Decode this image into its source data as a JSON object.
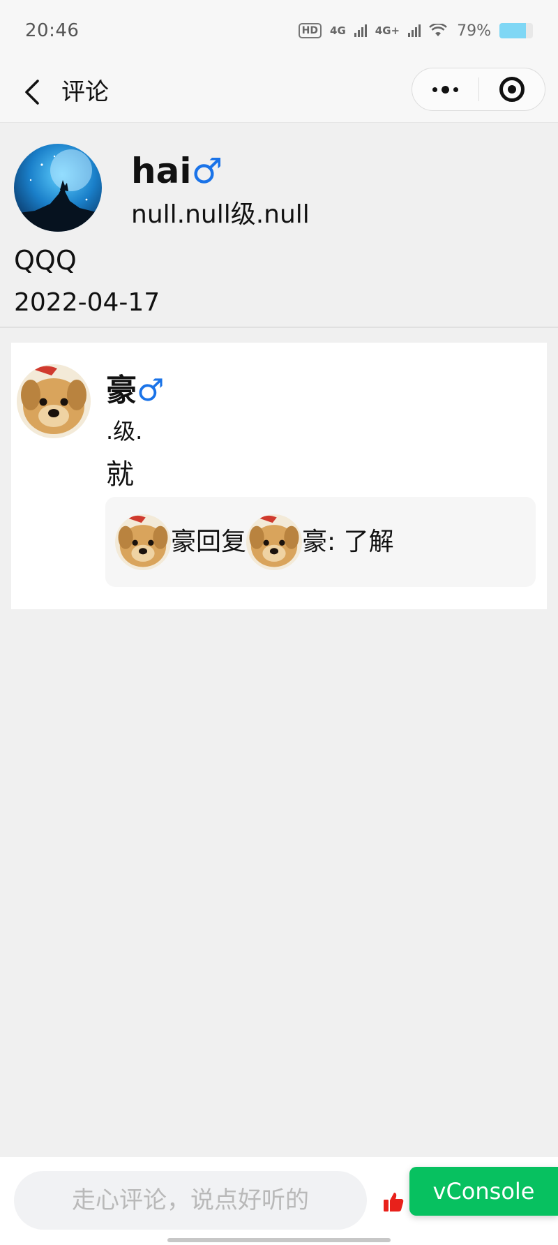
{
  "status_bar": {
    "time": "20:46",
    "hd_label": "HD",
    "net1": "4G",
    "net2": "4G+",
    "battery_text": "79%",
    "battery_level": 0.79
  },
  "nav": {
    "title": "评论"
  },
  "post": {
    "author_name": "hai",
    "gender_symbol": "♂",
    "level": "null.null级.null",
    "content": "QQQ",
    "date": "2022-04-17"
  },
  "comment": {
    "author_name": "豪",
    "gender_symbol": "♂",
    "level": ".级.",
    "text": "就",
    "reply": {
      "from_name": "豪",
      "verb": "回复",
      "to_name": "豪",
      "content": ": 了解"
    }
  },
  "bottom": {
    "input_placeholder": "走心评论，说点好听的",
    "vconsole_label": "vConsole"
  },
  "colors": {
    "male_blue": "#1a73e8",
    "vconsole_green": "#07c160",
    "thumb_red": "#e8211b"
  }
}
